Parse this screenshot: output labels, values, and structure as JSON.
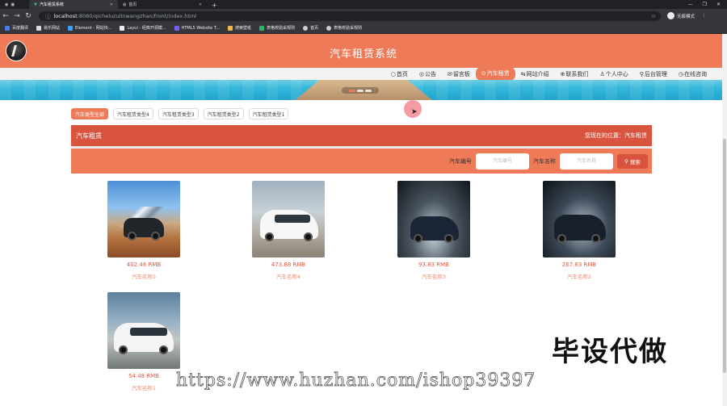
{
  "browser": {
    "tabs": [
      {
        "label": "汽车租赁系统",
        "active": true
      },
      {
        "label": "首页",
        "active": false
      }
    ],
    "url_host": "localhost",
    "url_path": ":8080/qicheluzulinwangzhan/front/index.html",
    "incognito_label": "无痕模式",
    "bookmarks": [
      "百度翻译",
      "易乐网站",
      "Element - 网站快...",
      "Layui - 经典开源模...",
      "HTML5 Website T...",
      "搜索壁纸",
      "表格校验采规则",
      "首页",
      "表格校验采规则"
    ]
  },
  "header": {
    "title": "汽车租赁系统"
  },
  "nav": {
    "items": [
      {
        "icon": "○",
        "label": "首页"
      },
      {
        "icon": "◎",
        "label": "公告"
      },
      {
        "icon": "✉",
        "label": "留言板"
      },
      {
        "icon": "⊙",
        "label": "汽车租赁",
        "active": true
      },
      {
        "icon": "⇆",
        "label": "网站介绍"
      },
      {
        "icon": "⊕",
        "label": "联系我们"
      },
      {
        "icon": "♙",
        "label": "个人中心"
      },
      {
        "icon": "⚲",
        "label": "后台管理"
      },
      {
        "icon": "◷",
        "label": "在线咨询"
      }
    ]
  },
  "categories": [
    "汽车类型全部",
    "汽车租赁类型4",
    "汽车租赁类型3",
    "汽车租赁类型2",
    "汽车租赁类型1"
  ],
  "breadcrumb": {
    "title": "汽车租赁",
    "location": "您现在的位置：汽车租赁"
  },
  "search": {
    "field1_label": "汽车编号",
    "field1_placeholder": "汽车编号",
    "field2_label": "汽车名称",
    "field2_placeholder": "汽车名称",
    "button_label": "搜索"
  },
  "cars": [
    {
      "price": "402.46 RMB",
      "name": "汽车名称5"
    },
    {
      "price": "473.88 RMB",
      "name": "汽车名称4"
    },
    {
      "price": "93.83 RMB",
      "name": "汽车名称3"
    },
    {
      "price": "267.83 RMB",
      "name": "汽车名称2"
    },
    {
      "price": "54.48 RMB",
      "name": "汽车名称1"
    }
  ],
  "watermark": {
    "big": "毕设代做",
    "url": "https://www.huzhan.com/ishop39397"
  },
  "colors": {
    "accent": "#ef7a58",
    "dark_accent": "#d9543e"
  }
}
